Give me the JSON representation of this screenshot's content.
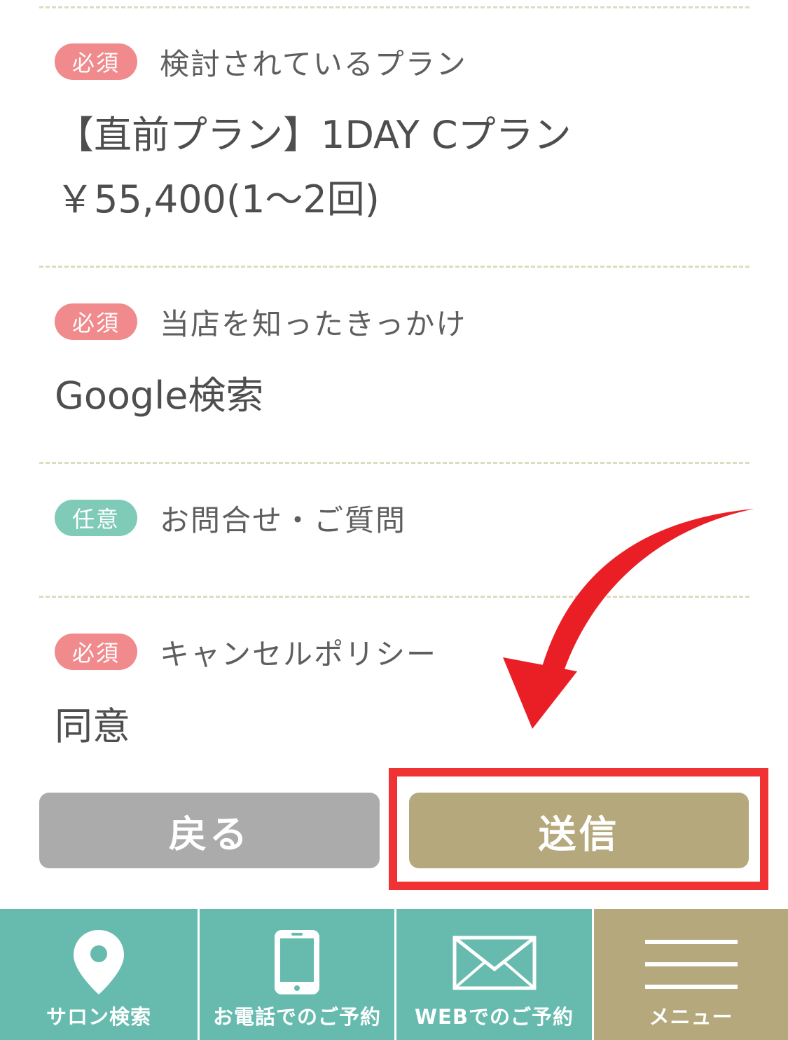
{
  "form": {
    "plan": {
      "badge": "必須",
      "label": "検討されているプラン",
      "value_line1": "【直前プラン】1DAY Cプラン",
      "value_line2": "￥55,400(1～2回)"
    },
    "source": {
      "badge": "必須",
      "label": "当店を知ったきっかけ",
      "value": "Google検索"
    },
    "inquiry": {
      "badge": "任意",
      "label": "お問合せ・ご質問",
      "value": ""
    },
    "cancel_policy": {
      "badge": "必須",
      "label": "キャンセルポリシー",
      "value": "同意"
    }
  },
  "actions": {
    "back_label": "戻る",
    "send_label": "送信"
  },
  "bottom_nav": {
    "items": [
      {
        "label": "サロン検索",
        "icon": "map-pin-icon"
      },
      {
        "label": "お電話でのご予約",
        "icon": "smartphone-icon"
      },
      {
        "label": "WEBでのご予約",
        "icon": "envelope-icon"
      },
      {
        "label": "メニュー",
        "icon": "hamburger-menu-icon"
      }
    ]
  },
  "colors": {
    "required_badge": "#f08a8c",
    "optional_badge": "#7fcbb8",
    "send_button": "#b4a87c",
    "back_button": "#ababab",
    "nav_teal": "#66bbae",
    "annotation_red": "#f03234"
  }
}
